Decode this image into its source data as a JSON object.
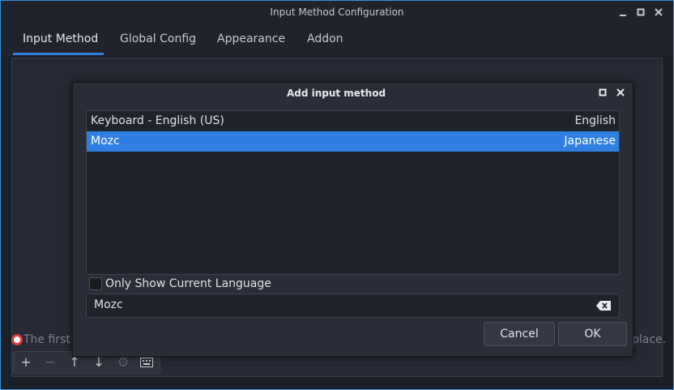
{
  "window": {
    "title": "Input Method Configuration"
  },
  "tabs": [
    {
      "label": "Input Method",
      "active": true
    },
    {
      "label": "Global Config",
      "active": false
    },
    {
      "label": "Appearance",
      "active": false
    },
    {
      "label": "Addon",
      "active": false
    }
  ],
  "note": {
    "text_left": "The first i",
    "text_right": "place."
  },
  "dialog": {
    "title": "Add input method",
    "list": [
      {
        "name": "Keyboard - English (US)",
        "language": "English",
        "selected": false
      },
      {
        "name": "Mozc",
        "language": "Japanese",
        "selected": true
      }
    ],
    "only_current_language_label": "Only Show Current Language",
    "only_current_language_checked": false,
    "search_value": "Mozc",
    "cancel_label": "Cancel",
    "ok_label": "OK"
  },
  "toolbar_icons": [
    "add-icon",
    "remove-icon",
    "arrow-up-icon",
    "arrow-down-icon",
    "gear-icon",
    "keyboard-icon"
  ],
  "colors": {
    "accent": "#2f7fe0",
    "background": "#1c1f26",
    "dialog": "#2a2d37"
  }
}
